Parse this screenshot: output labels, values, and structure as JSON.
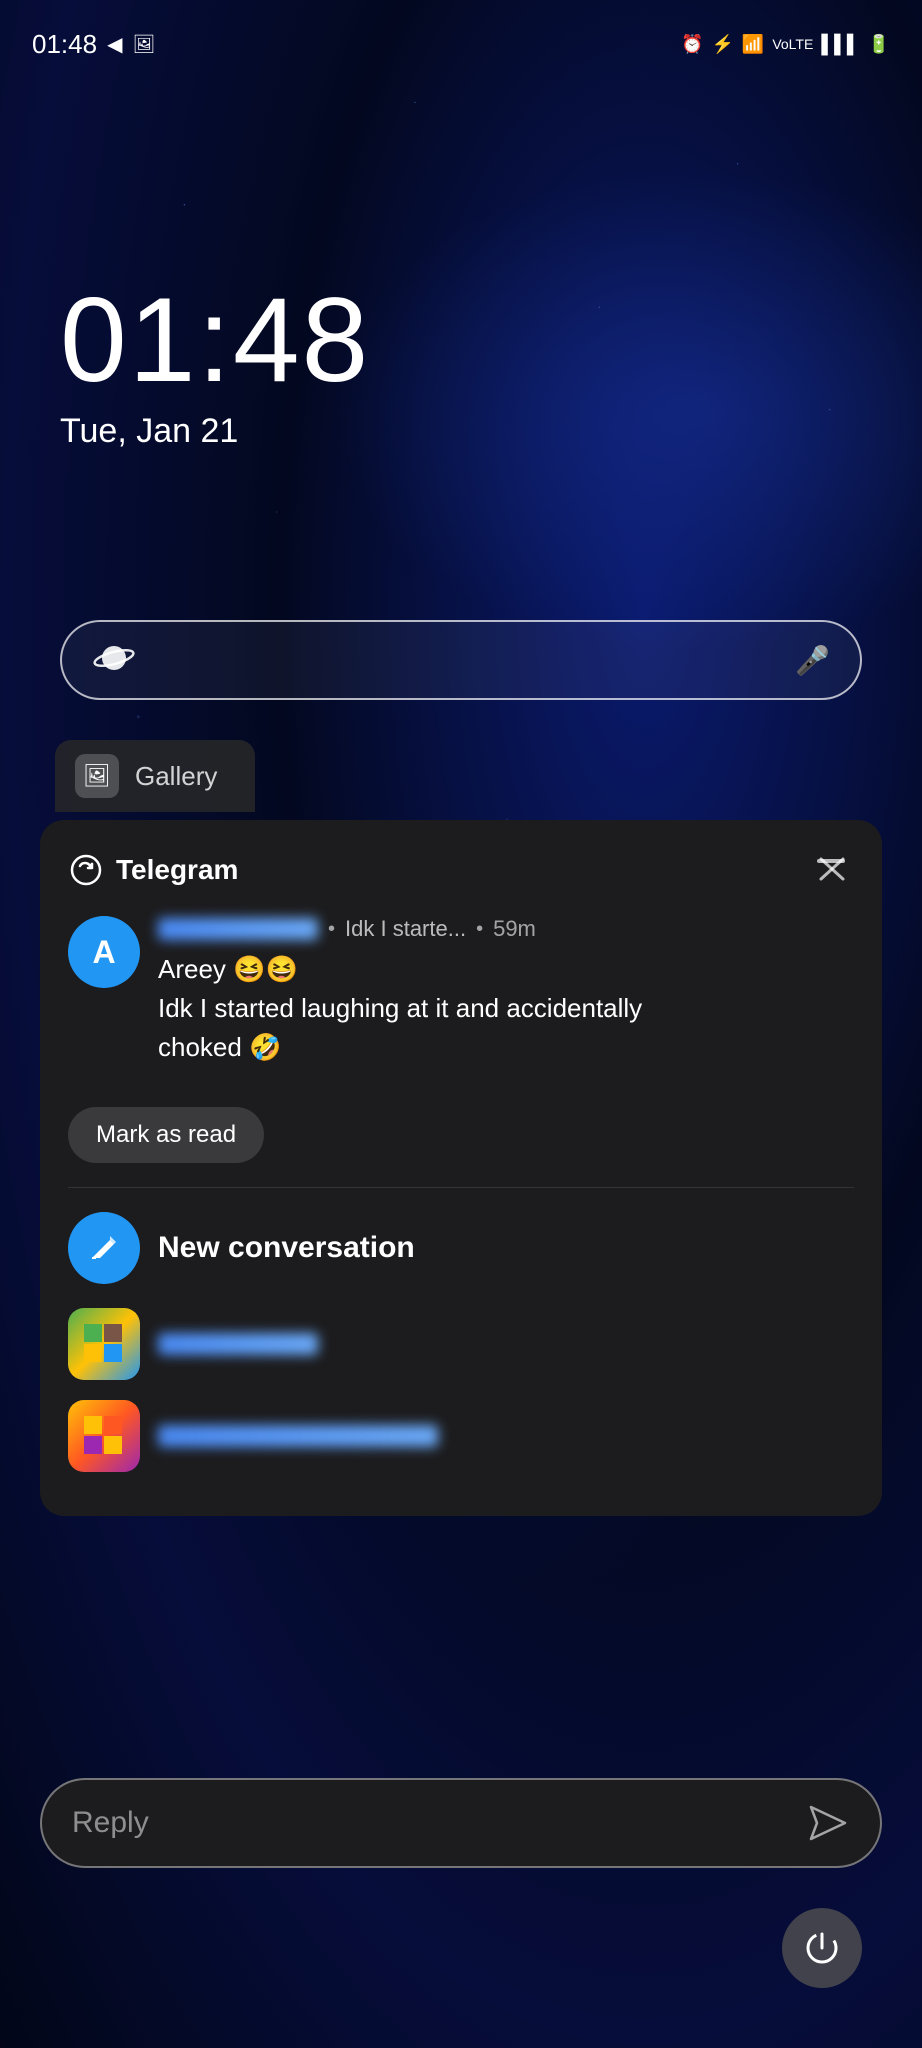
{
  "statusBar": {
    "time": "01:48",
    "leftIcons": [
      "navigation-icon",
      "gallery-icon"
    ],
    "rightIcons": [
      "alarm-icon",
      "bluetooth-icon",
      "wifi-icon",
      "volte-icon",
      "signal-icon",
      "battery-icon"
    ]
  },
  "lockScreen": {
    "time": "01:48",
    "date": "Tue, Jan 21"
  },
  "searchBar": {
    "placeholder": ""
  },
  "galleryPeek": {
    "label": "Gallery"
  },
  "notification": {
    "appName": "Telegram",
    "senderInitial": "A",
    "messagePreview": "Idk I starte...",
    "timeAgo": "59m",
    "bodyLine1": "Areey 😆😆",
    "bodyLine2": "Idk I started laughing at it and accidentally",
    "bodyLine3": "choked 🤣",
    "markAsRead": "Mark as read",
    "newConversation": "New conversation",
    "replyPlaceholder": "Reply",
    "sendButton": "➤"
  }
}
